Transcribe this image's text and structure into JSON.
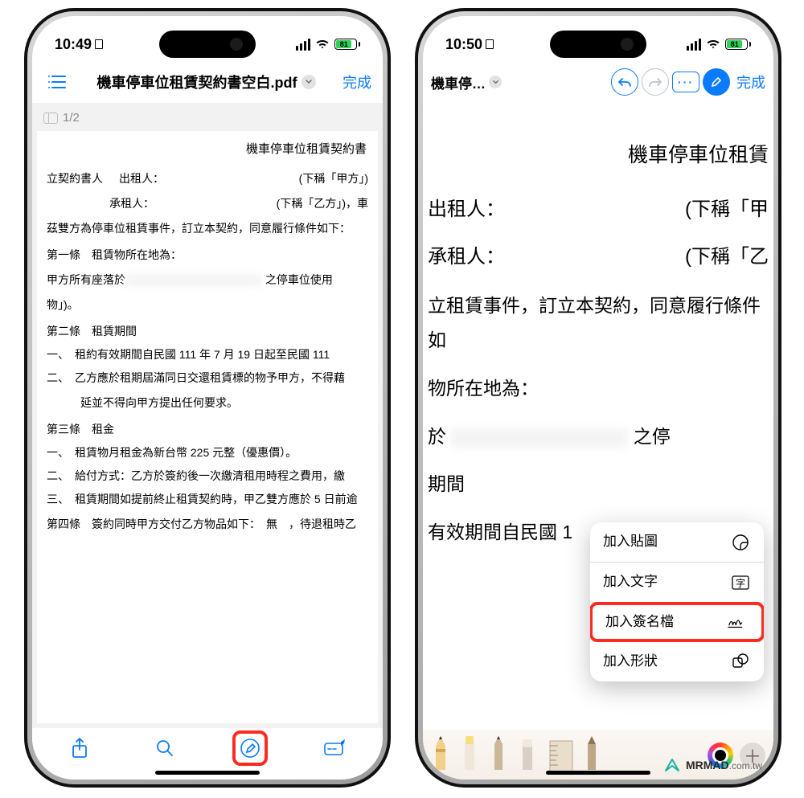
{
  "statusbar": {
    "time_left": "10:49",
    "time_right": "10:50",
    "battery_pct": "81"
  },
  "left": {
    "nav": {
      "filename": "機車停車位租賃契約書空白.pdf",
      "done": "完成"
    },
    "page_indicator": "1/2",
    "doc": {
      "title": "機車停車位租賃契約書",
      "contracting_label": "立契約書人",
      "lessor_label": "出租人：",
      "lessor_trail": "(下稱「甲方」)",
      "lessee_label": "承租人：",
      "lessee_trail": "(下稱「乙方」)，車",
      "preamble": "茲雙方為停車位租賃事件，訂立本契約，同意履行條件如下：",
      "sec1": "第一條　租賃物所在地為：",
      "sec1_body_a": "甲方所有座落於",
      "sec1_body_b": "之停車位使用",
      "sec1_body_c": "物」)。",
      "sec2": "第二條　租賃期間",
      "sec2_i1": "一、　租約有效期間自民國 111 年 7 月 19 日起至民國 111",
      "sec2_i2": "二、　乙方應於租期屆滿同日交還租賃標的物予甲方，不得藉",
      "sec2_i2b": "延並不得向甲方提出任何要求。",
      "sec3": "第三條　租金",
      "sec3_i1": "一、　租賃物月租金為新台幣 225 元整（優惠價）。",
      "sec3_i2": "二、　給付方式：乙方於簽約後一次繳清租用時程之費用，繳",
      "sec3_i3": "三、　租賃期間如提前終止租賃契約時，甲乙雙方應於 5 日前逾",
      "sec4": "第四條　簽約同時甲方交付乙方物品如下：　無　，待退租時乙"
    }
  },
  "right": {
    "nav": {
      "filename_short": "機車停…",
      "done": "完成"
    },
    "doc": {
      "title": "機車停車位租賃",
      "lessor_label": "出租人：",
      "lessor_trail": "(下稱「甲",
      "lessee_label": "承租人：",
      "lessee_trail": "(下稱「乙",
      "line1": "立租賃事件，訂立本契約，同意履行條件如",
      "line2": "物所在地為：",
      "line3_pre": "於",
      "line3_suf": "之停",
      "line4": "期間",
      "line5": "有效期間自民國 1"
    },
    "popup": {
      "sticker": "加入貼圖",
      "text": "加入文字",
      "signature": "加入簽名檔",
      "shape": "加入形狀"
    }
  },
  "watermark": {
    "name": "MRMAD",
    "tld": ".com.tw"
  }
}
